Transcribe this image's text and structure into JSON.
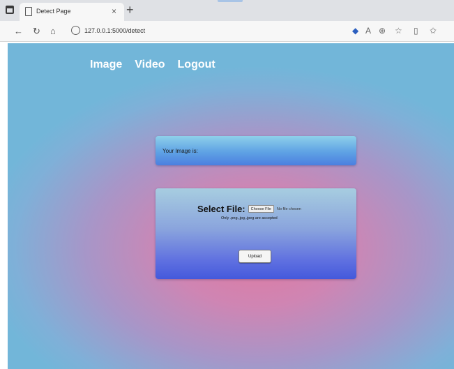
{
  "browser": {
    "tab_title": "Detect Page",
    "tab_close": "×",
    "new_tab": "+",
    "address": "127.0.0.1:5000/detect",
    "icons": [
      "window-menu-icon",
      "page-icon",
      "back-arrow-icon",
      "reload-icon",
      "home-icon",
      "site-info-icon",
      "extension-icon",
      "read-aloud-icon",
      "zoom-icon",
      "favorites-icon",
      "split-screen-icon",
      "collections-icon"
    ]
  },
  "nav": {
    "image_label": "Image",
    "video_label": "Video",
    "logout_label": "Logout"
  },
  "result": {
    "text": "Your Image is:"
  },
  "upload": {
    "select_label": "Select File:",
    "choose_button": "Choose File",
    "no_file_text": "No file chosen",
    "note": "Only .png,.jpg,.jpeg are accepted",
    "upload_button": "Upload"
  },
  "colors": {
    "nav_text": "#ffffff",
    "result_box_top": "#8ed0ea",
    "result_box_bottom": "#4b7fe0",
    "upload_box_top": "#a7cde0",
    "upload_box_bottom": "#4459dc",
    "background_center": "#e07aa0",
    "background_edge": "#72b6d9"
  }
}
